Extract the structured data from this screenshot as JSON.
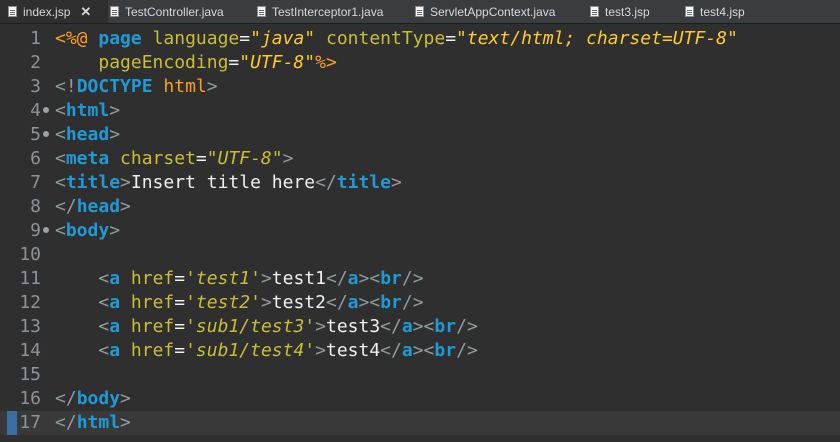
{
  "tabs": [
    {
      "label": "index.jsp",
      "active": true,
      "closable": true
    },
    {
      "label": "TestController.java"
    },
    {
      "label": "TestInterceptor1.java"
    },
    {
      "label": "ServletAppContext.java"
    },
    {
      "label": "test3.jsp"
    },
    {
      "label": "test4.jsp"
    }
  ],
  "editor": {
    "current_line": 17,
    "lines": [
      {
        "num": "1",
        "tokens": [
          [
            "t-dir",
            "<%@ "
          ],
          [
            "t-kw",
            "page"
          ],
          [
            "t-txt",
            " "
          ],
          [
            "t-attr",
            "language"
          ],
          [
            "t-txt",
            "="
          ],
          [
            "t-str2",
            "\"java\""
          ],
          [
            "t-txt",
            " "
          ],
          [
            "t-attr",
            "contentType"
          ],
          [
            "t-txt",
            "="
          ],
          [
            "t-str2",
            "\"text/html; charset=UTF-8\""
          ]
        ]
      },
      {
        "num": "2",
        "tokens": [
          [
            "t-txt",
            "    "
          ],
          [
            "t-attr",
            "pageEncoding"
          ],
          [
            "t-txt",
            "="
          ],
          [
            "t-str2",
            "\"UTF-8\""
          ],
          [
            "t-dir",
            "%>"
          ]
        ]
      },
      {
        "num": "3",
        "tokens": [
          [
            "t-punct",
            "<!"
          ],
          [
            "t-kw",
            "DOCTYPE "
          ],
          [
            "t-dt",
            "html"
          ],
          [
            "t-punct",
            ">"
          ]
        ]
      },
      {
        "num": "4",
        "fold": true,
        "tokens": [
          [
            "t-punct",
            "<"
          ],
          [
            "t-kw",
            "html"
          ],
          [
            "t-punct",
            ">"
          ]
        ]
      },
      {
        "num": "5",
        "fold": true,
        "tokens": [
          [
            "t-punct",
            "<"
          ],
          [
            "t-kw",
            "head"
          ],
          [
            "t-punct",
            ">"
          ]
        ]
      },
      {
        "num": "6",
        "tokens": [
          [
            "t-punct",
            "<"
          ],
          [
            "t-kw",
            "meta"
          ],
          [
            "t-txt",
            " "
          ],
          [
            "t-attr",
            "charset"
          ],
          [
            "t-txt",
            "="
          ],
          [
            "t-str",
            "\"UTF-8\""
          ],
          [
            "t-punct",
            ">"
          ]
        ]
      },
      {
        "num": "7",
        "tokens": [
          [
            "t-punct",
            "<"
          ],
          [
            "t-kw",
            "title"
          ],
          [
            "t-punct",
            ">"
          ],
          [
            "t-txt",
            "Insert title here"
          ],
          [
            "t-punct",
            "</"
          ],
          [
            "t-kw",
            "title"
          ],
          [
            "t-punct",
            ">"
          ]
        ]
      },
      {
        "num": "8",
        "tokens": [
          [
            "t-punct",
            "</"
          ],
          [
            "t-kw",
            "head"
          ],
          [
            "t-punct",
            ">"
          ]
        ]
      },
      {
        "num": "9",
        "fold": true,
        "tokens": [
          [
            "t-punct",
            "<"
          ],
          [
            "t-kw",
            "body"
          ],
          [
            "t-punct",
            ">"
          ]
        ]
      },
      {
        "num": "10",
        "tokens": []
      },
      {
        "num": "11",
        "tokens": [
          [
            "t-txt",
            "    "
          ],
          [
            "t-punct",
            "<"
          ],
          [
            "t-kw",
            "a"
          ],
          [
            "t-txt",
            " "
          ],
          [
            "t-attr",
            "href"
          ],
          [
            "t-txt",
            "="
          ],
          [
            "t-str",
            "'test1'"
          ],
          [
            "t-punct",
            ">"
          ],
          [
            "t-txt",
            "test1"
          ],
          [
            "t-punct",
            "</"
          ],
          [
            "t-kw",
            "a"
          ],
          [
            "t-punct",
            "><"
          ],
          [
            "t-kw",
            "br"
          ],
          [
            "t-punct",
            "/>"
          ]
        ]
      },
      {
        "num": "12",
        "tokens": [
          [
            "t-txt",
            "    "
          ],
          [
            "t-punct",
            "<"
          ],
          [
            "t-kw",
            "a"
          ],
          [
            "t-txt",
            " "
          ],
          [
            "t-attr",
            "href"
          ],
          [
            "t-txt",
            "="
          ],
          [
            "t-str",
            "'test2'"
          ],
          [
            "t-punct",
            ">"
          ],
          [
            "t-txt",
            "test2"
          ],
          [
            "t-punct",
            "</"
          ],
          [
            "t-kw",
            "a"
          ],
          [
            "t-punct",
            "><"
          ],
          [
            "t-kw",
            "br"
          ],
          [
            "t-punct",
            "/>"
          ]
        ]
      },
      {
        "num": "13",
        "tokens": [
          [
            "t-txt",
            "    "
          ],
          [
            "t-punct",
            "<"
          ],
          [
            "t-kw",
            "a"
          ],
          [
            "t-txt",
            " "
          ],
          [
            "t-attr",
            "href"
          ],
          [
            "t-txt",
            "="
          ],
          [
            "t-str",
            "'sub1/test3'"
          ],
          [
            "t-punct",
            ">"
          ],
          [
            "t-txt",
            "test3"
          ],
          [
            "t-punct",
            "</"
          ],
          [
            "t-kw",
            "a"
          ],
          [
            "t-punct",
            "><"
          ],
          [
            "t-kw",
            "br"
          ],
          [
            "t-punct",
            "/>"
          ]
        ]
      },
      {
        "num": "14",
        "tokens": [
          [
            "t-txt",
            "    "
          ],
          [
            "t-punct",
            "<"
          ],
          [
            "t-kw",
            "a"
          ],
          [
            "t-txt",
            " "
          ],
          [
            "t-attr",
            "href"
          ],
          [
            "t-txt",
            "="
          ],
          [
            "t-str",
            "'sub1/test4'"
          ],
          [
            "t-punct",
            ">"
          ],
          [
            "t-txt",
            "test4"
          ],
          [
            "t-punct",
            "</"
          ],
          [
            "t-kw",
            "a"
          ],
          [
            "t-punct",
            "><"
          ],
          [
            "t-kw",
            "br"
          ],
          [
            "t-punct",
            "/>"
          ]
        ]
      },
      {
        "num": "15",
        "tokens": []
      },
      {
        "num": "16",
        "tokens": [
          [
            "t-punct",
            "</"
          ],
          [
            "t-kw",
            "body"
          ],
          [
            "t-punct",
            ">"
          ]
        ]
      },
      {
        "num": "17",
        "tokens": [
          [
            "t-punct",
            "</"
          ],
          [
            "t-kw",
            "html"
          ],
          [
            "t-punct",
            ">"
          ]
        ]
      }
    ]
  }
}
